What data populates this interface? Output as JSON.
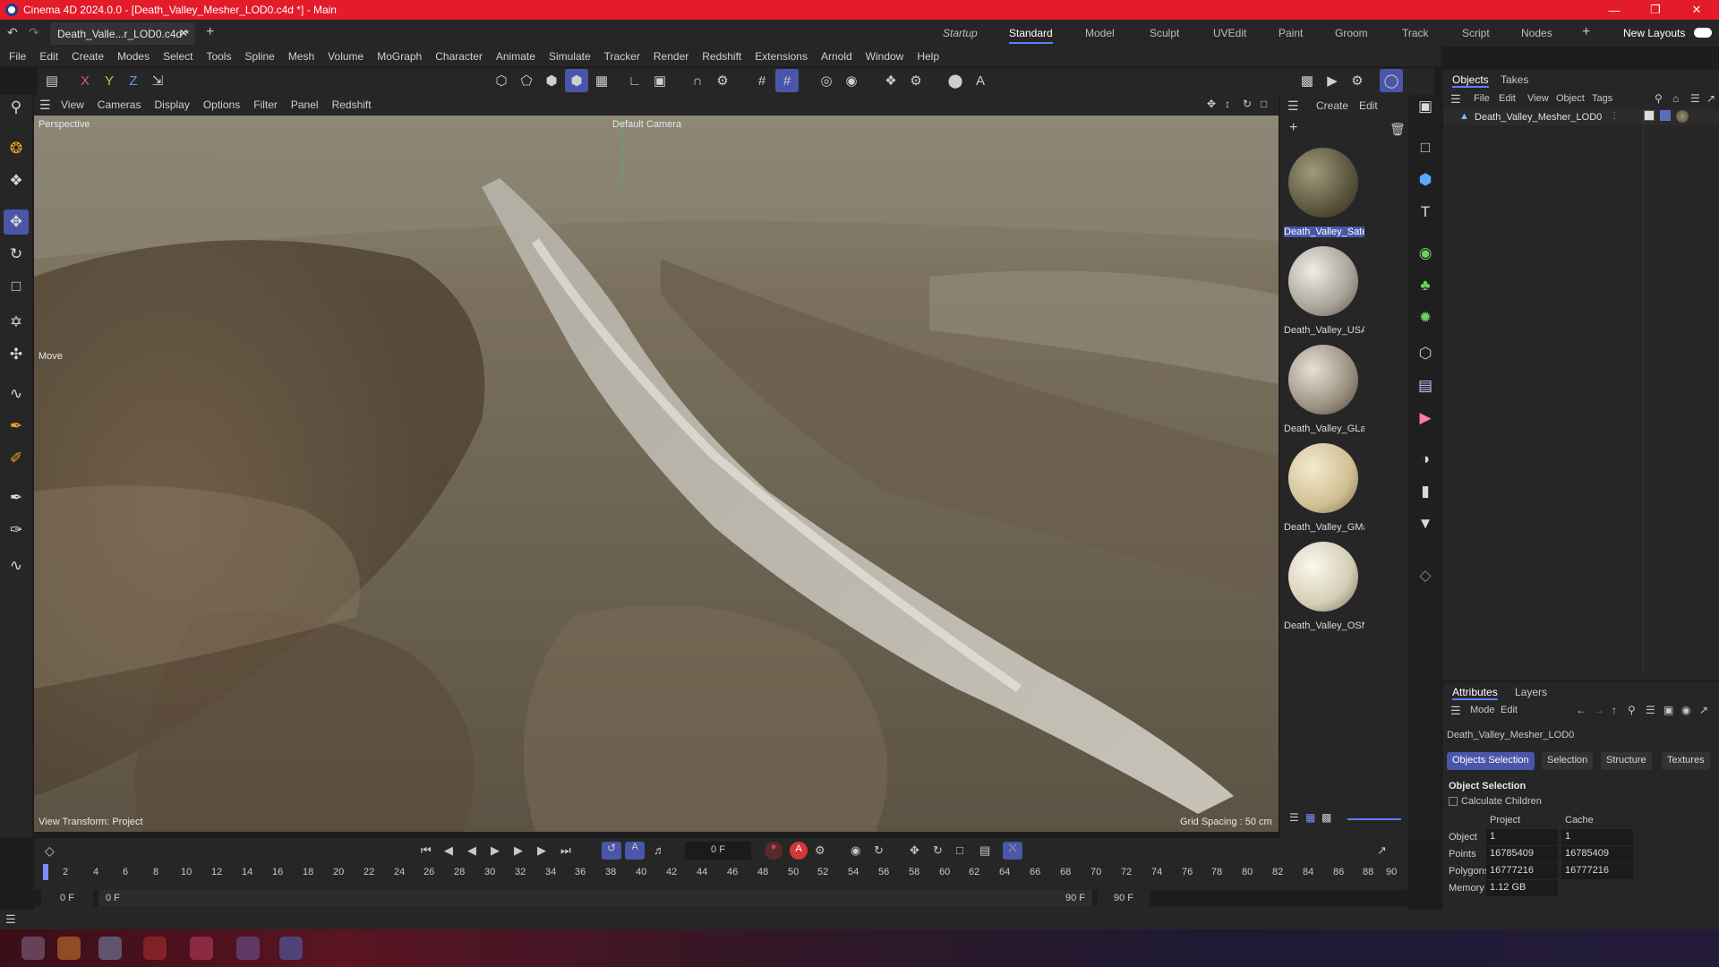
{
  "window": {
    "title": "Cinema 4D 2024.0.0 - [Death_Valley_Mesher_LOD0.c4d *] - Main"
  },
  "document_tab": {
    "label": "Death_Valle...r_LOD0.c4d *"
  },
  "layouts": [
    "Startup",
    "Standard",
    "Model",
    "Sculpt",
    "UVEdit",
    "Paint",
    "Groom",
    "Track",
    "Script",
    "Nodes"
  ],
  "layout_active": "Standard",
  "new_layouts_label": "New Layouts",
  "menu": [
    "File",
    "Edit",
    "Create",
    "Modes",
    "Select",
    "Tools",
    "Spline",
    "Mesh",
    "Volume",
    "MoGraph",
    "Character",
    "Animate",
    "Simulate",
    "Tracker",
    "Render",
    "Redshift",
    "Extensions",
    "Arnold",
    "Window",
    "Help"
  ],
  "axis": {
    "x": "X",
    "y": "Y",
    "z": "Z"
  },
  "viewport": {
    "menu": [
      "View",
      "Cameras",
      "Display",
      "Options",
      "Filter",
      "Panel",
      "Redshift"
    ],
    "projection": "Perspective",
    "camera": "Default Camera",
    "tool_hint": "Move",
    "view_transform": "View Transform: Project",
    "grid_spacing": "Grid Spacing : 50 cm"
  },
  "material_manager": {
    "menu": [
      "Create",
      "Edit"
    ],
    "materials": [
      {
        "name": "Death_Valley_Sate",
        "color": "#6f6a4c"
      },
      {
        "name": "Death_Valley_USA",
        "color": "#b9b3a8"
      },
      {
        "name": "Death_Valley_GLa",
        "color": "#a89f8e"
      },
      {
        "name": "Death_Valley_GMa",
        "color": "#d6c9a1"
      },
      {
        "name": "Death_Valley_OSN",
        "color": "#d8d2bf"
      }
    ]
  },
  "objects_panel": {
    "tabs": [
      "Objects",
      "Takes"
    ],
    "menu": [
      "File",
      "Edit",
      "View",
      "Object",
      "Tags"
    ],
    "items": [
      {
        "name": "Death_Valley_Mesher_LOD0"
      }
    ]
  },
  "attributes_panel": {
    "tabs": [
      "Attributes",
      "Layers"
    ],
    "menu": [
      "Mode",
      "Edit"
    ],
    "object_name": "Death_Valley_Mesher_LOD0",
    "section_tabs": [
      "Objects Selection",
      "Selection",
      "Structure",
      "Textures"
    ],
    "section_title": "Object Selection",
    "checkbox_label": "Calculate Children",
    "table": {
      "headers": [
        "Project",
        "Cache"
      ],
      "rows": [
        {
          "label": "Object",
          "project": "1",
          "cache": "1"
        },
        {
          "label": "Points",
          "project": "16785409",
          "cache": "16785409"
        },
        {
          "label": "Polygons",
          "project": "16777216",
          "cache": "16777216"
        },
        {
          "label": "Memory",
          "project": "1.12 GB",
          "cache": ""
        }
      ]
    }
  },
  "timeline": {
    "current_frame": "0 F",
    "start_field": "0 F",
    "start_field2": "0 F",
    "end_field": "90 F",
    "end_field2": "90 F",
    "ticks": [
      "0",
      "2",
      "4",
      "6",
      "8",
      "10",
      "12",
      "14",
      "16",
      "18",
      "20",
      "22",
      "24",
      "26",
      "28",
      "30",
      "32",
      "34",
      "36",
      "38",
      "40",
      "42",
      "44",
      "46",
      "48",
      "50",
      "52",
      "54",
      "56",
      "58",
      "60",
      "62",
      "64",
      "66",
      "68",
      "70",
      "72",
      "74",
      "76",
      "78",
      "80",
      "82",
      "84",
      "86",
      "88",
      "90"
    ]
  }
}
